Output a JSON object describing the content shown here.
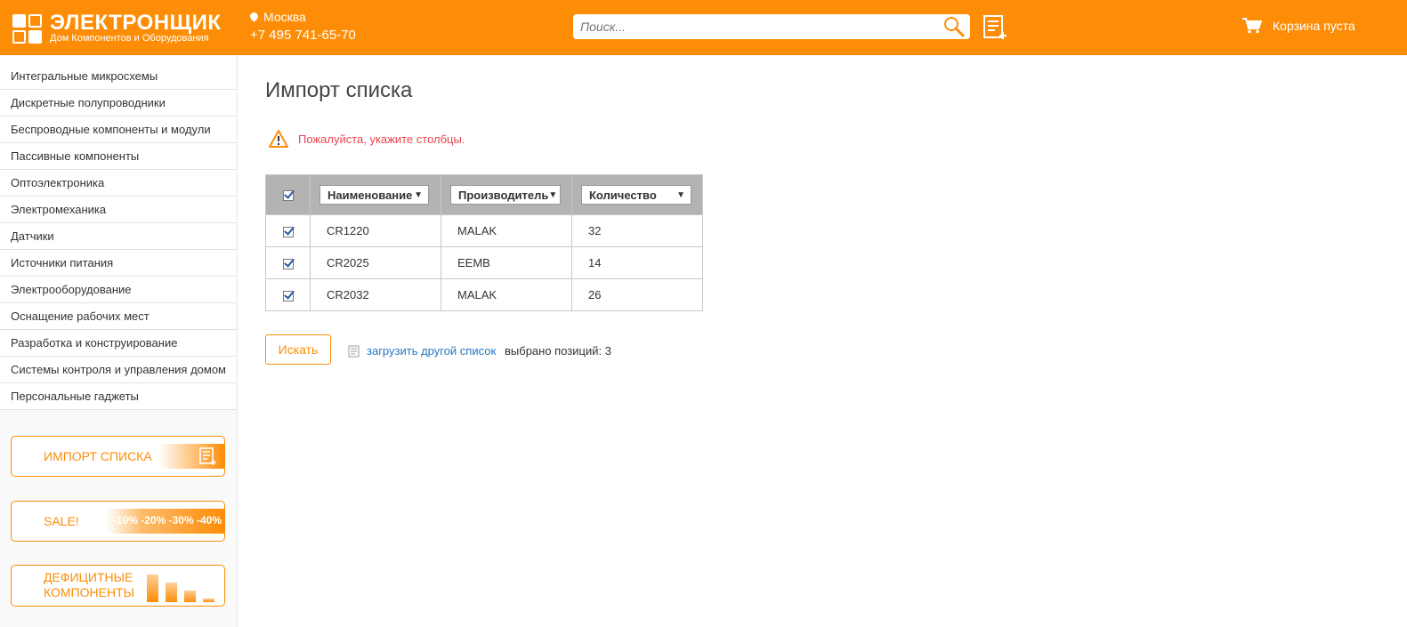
{
  "header": {
    "logo_title": "ЭЛЕКТРОНЩИК",
    "logo_subtitle": "Дом Компонентов и Оборудования",
    "city": "Москва",
    "phone": "+7 495 741-65-70",
    "search_placeholder": "Поиск...",
    "cart_label": "Корзина пуста"
  },
  "sidebar": {
    "categories": [
      "Интегральные микросхемы",
      "Дискретные полупроводники",
      "Беспроводные компоненты и модули",
      "Пассивные компоненты",
      "Оптоэлектроника",
      "Электромеханика",
      "Датчики",
      "Источники питания",
      "Электрооборудование",
      "Оснащение рабочих мест",
      "Разработка и конструирование",
      "Системы контроля и управления домом",
      "Персональные гаджеты"
    ],
    "promo_import": "ИМПОРТ СПИСКА",
    "promo_sale": "SALE!",
    "promo_sale_pct": "-10% -20% -30% -40%",
    "promo_deficit_line1": "ДЕФИЦИТНЫЕ",
    "promo_deficit_line2": "КОМПОНЕНТЫ"
  },
  "main": {
    "title": "Импорт списка",
    "warning": "Пожалуйста, укажите столбцы.",
    "columns": [
      "Наименование",
      "Производитель",
      "Количество"
    ],
    "rows": [
      {
        "name": "CR1220",
        "maker": "MALAK",
        "qty": "32"
      },
      {
        "name": "CR2025",
        "maker": "EEMB",
        "qty": "14"
      },
      {
        "name": "CR2032",
        "maker": "MALAK",
        "qty": "26"
      }
    ],
    "search_button": "Искать",
    "reload_link": "загрузить другой список",
    "selected_count": "выбрано позиций: 3"
  },
  "colors": {
    "brand_orange": "#fd8d07",
    "warning_red": "#e8454f",
    "link_blue": "#2576c4",
    "table_header_gray": "#b3b3b3"
  }
}
